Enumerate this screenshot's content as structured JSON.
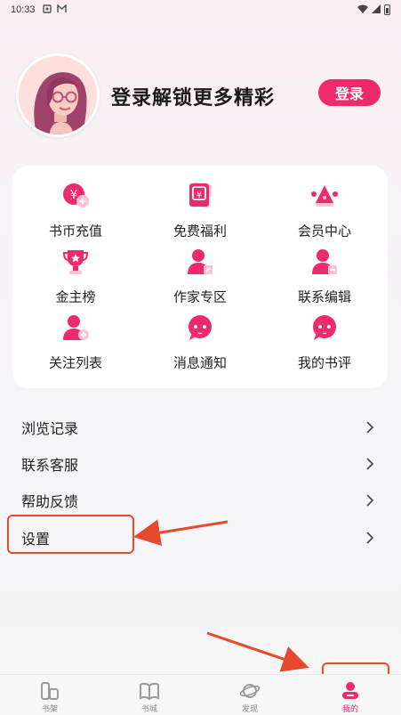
{
  "status_bar": {
    "time": "10:33",
    "icons": [
      "notification-icon",
      "mail-icon"
    ],
    "right_icons": [
      "wifi-icon",
      "signal-icon",
      "battery-icon"
    ]
  },
  "header": {
    "prompt": "登录解锁更多精彩",
    "login_label": "登录"
  },
  "grid": [
    {
      "label": "书币充值",
      "icon": "coin-icon"
    },
    {
      "label": "免费福利",
      "icon": "gift-card-icon"
    },
    {
      "label": "会员中心",
      "icon": "crown-icon"
    },
    {
      "label": "金主榜",
      "icon": "trophy-icon"
    },
    {
      "label": "作家专区",
      "icon": "writer-icon"
    },
    {
      "label": "联系编辑",
      "icon": "editor-icon"
    },
    {
      "label": "关注列表",
      "icon": "follow-icon"
    },
    {
      "label": "消息通知",
      "icon": "message-icon"
    },
    {
      "label": "我的书评",
      "icon": "review-icon"
    }
  ],
  "menu": [
    {
      "label": "浏览记录"
    },
    {
      "label": "联系客服"
    },
    {
      "label": "帮助反馈"
    },
    {
      "label": "设置"
    }
  ],
  "tabs": [
    {
      "label": "书架",
      "icon": "bookshelf-icon"
    },
    {
      "label": "书城",
      "icon": "book-icon"
    },
    {
      "label": "发现",
      "icon": "planet-icon"
    },
    {
      "label": "我的",
      "icon": "profile-icon",
      "active": true
    }
  ],
  "colors": {
    "accent": "#ee2a6c",
    "annotation": "#e64a2e"
  }
}
